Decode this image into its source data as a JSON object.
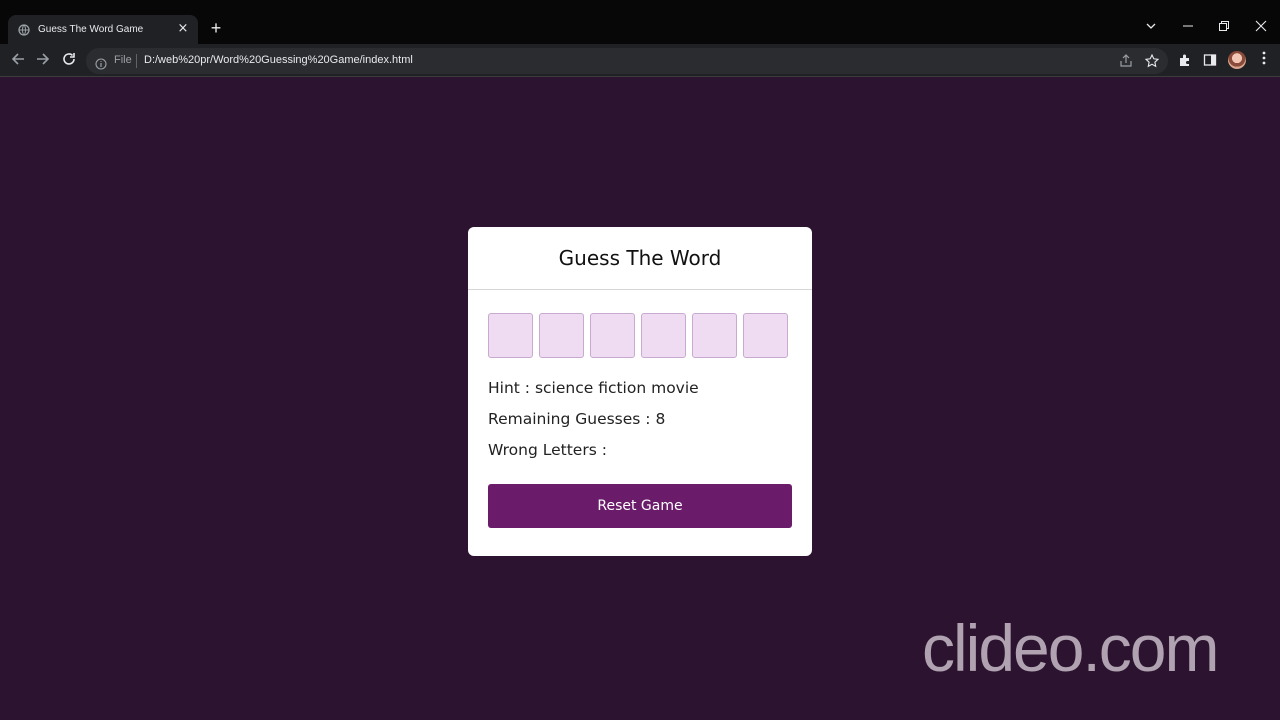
{
  "browser": {
    "tab_title": "Guess The Word Game",
    "tab_close": "×",
    "new_tab": "+",
    "file_label": "File",
    "url": "D:/web%20pr/Word%20Guessing%20Game/index.html"
  },
  "game": {
    "title": "Guess The Word",
    "letter_boxes": [
      "",
      "",
      "",
      "",
      "",
      ""
    ],
    "hint_label": "Hint : science fiction movie",
    "remaining_label": "Remaining Guesses : 8",
    "wrong_label": "Wrong Letters :",
    "reset_button": "Reset Game"
  },
  "watermark": "clideo.com",
  "colors": {
    "page_background": "#2c1430",
    "box_fill": "#efdcf3",
    "button": "#6a1b6a"
  }
}
